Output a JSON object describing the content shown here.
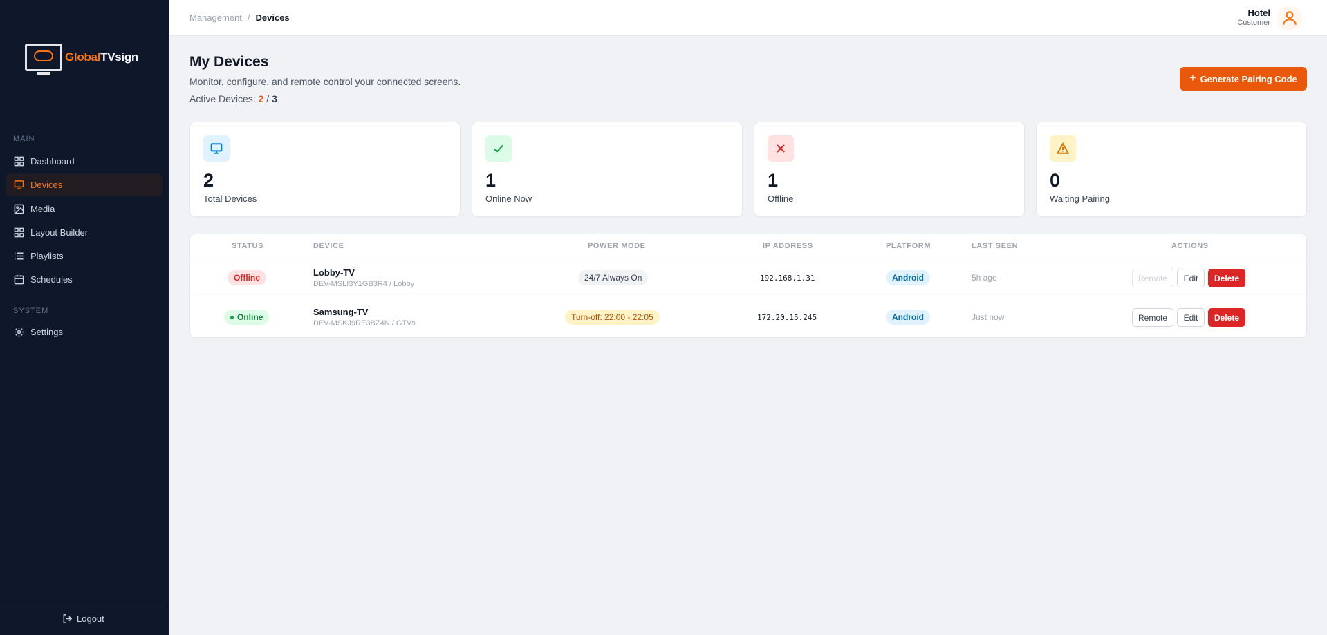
{
  "brand": {
    "name_part1": "Gl",
    "name_globe": "o",
    "name_part2": "bal",
    "name_part3": "TVsign"
  },
  "sidebar": {
    "sections": [
      {
        "label": "MAIN"
      },
      {
        "label": "SYSTEM"
      }
    ],
    "items": [
      {
        "label": "Dashboard",
        "icon": "grid-icon"
      },
      {
        "label": "Devices",
        "icon": "monitor-icon",
        "active": true
      },
      {
        "label": "Media",
        "icon": "image-icon"
      },
      {
        "label": "Layout Builder",
        "icon": "layout-icon"
      },
      {
        "label": "Playlists",
        "icon": "list-icon"
      },
      {
        "label": "Schedules",
        "icon": "calendar-icon"
      },
      {
        "label": "Settings",
        "icon": "gear-icon"
      }
    ],
    "logout": "Logout"
  },
  "topbar": {
    "breadcrumb": [
      "Management",
      "/",
      "Devices"
    ],
    "user": {
      "name": "Hotel",
      "role": "Customer"
    }
  },
  "page": {
    "title": "My Devices",
    "subtitle": "Monitor, configure, and remote control your connected screens.",
    "active_label": "Active Devices:",
    "active_count": "2",
    "separator": "/",
    "active_max": "3",
    "generate_button": "Generate Pairing Code"
  },
  "stats": [
    {
      "value": "2",
      "label": "Total Devices",
      "icon": "monitor-icon",
      "color": "#0284c7",
      "bg": "#e0f2fe"
    },
    {
      "value": "1",
      "label": "Online Now",
      "icon": "check-icon",
      "color": "#16a34a",
      "bg": "#dcfce7"
    },
    {
      "value": "1",
      "label": "Offline",
      "icon": "x-icon",
      "color": "#dc2626",
      "bg": "#fee2e2"
    },
    {
      "value": "0",
      "label": "Waiting Pairing",
      "icon": "warning-icon",
      "color": "#d97706",
      "bg": "#fef3c7"
    }
  ],
  "table": {
    "headers": [
      "STATUS",
      "DEVICE",
      "POWER MODE",
      "IP ADDRESS",
      "PLATFORM",
      "LAST SEEN",
      "ACTIONS"
    ],
    "rows": [
      {
        "status": "Offline",
        "name": "Lobby-TV",
        "sub": "DEV-MSLI3Y1GB3R4 / Lobby",
        "power": "24/7 Always On",
        "ip": "192.168.1.31",
        "platform": "Android",
        "last_seen": "5h ago",
        "remote": "Remote",
        "edit": "Edit",
        "delete": "Delete"
      },
      {
        "status": "Online",
        "name": "Samsung-TV",
        "sub": "DEV-MSKJ9RE3BZ4N / GTVs",
        "power": "Turn-off: 22:00 - 22:05",
        "ip": "172.20.15.245",
        "platform": "Android",
        "last_seen": "Just now",
        "remote": "Remote",
        "edit": "Edit",
        "delete": "Delete"
      }
    ]
  },
  "colors": {
    "accent": "#ea580c",
    "sidebar_bg": "#0f172a",
    "danger": "#dc2626",
    "success": "#16a34a"
  }
}
